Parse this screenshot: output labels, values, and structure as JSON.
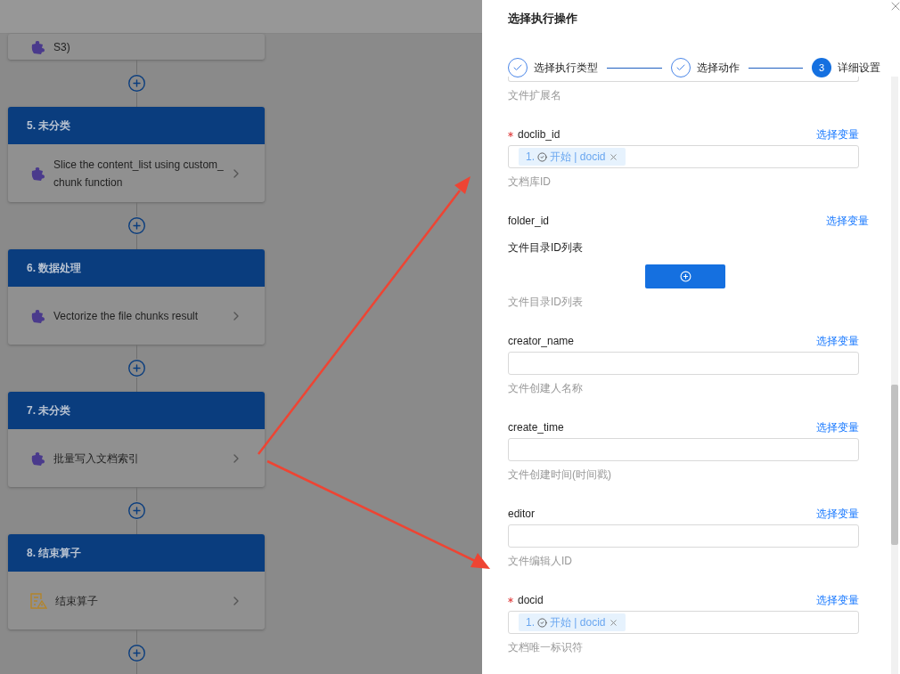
{
  "flow": {
    "nodes": [
      {
        "partial": true,
        "text": "S3)",
        "kind": "plugin"
      },
      {
        "title": "5. 未分类",
        "text": "Slice the content_list using custom_ chunk function",
        "kind": "plugin"
      },
      {
        "title": "6. 数据处理",
        "text": "Vectorize the file chunks result",
        "kind": "plugin"
      },
      {
        "title": "7. 未分类",
        "text": "批量写入文档索引",
        "kind": "plugin"
      },
      {
        "title": "8. 结束算子",
        "text": "结束算子",
        "kind": "end"
      }
    ]
  },
  "drawer": {
    "title": "选择执行操作",
    "steps": [
      {
        "label": "选择执行类型",
        "kind": "done"
      },
      {
        "label": "选择动作",
        "kind": "done"
      },
      {
        "label": "详细设置",
        "kind": "current",
        "number": "3"
      }
    ],
    "fields": [
      {
        "kind": "partial",
        "hint": "文件扩展名"
      },
      {
        "kind": "tags",
        "name": "doclib_id",
        "required": true,
        "link": "选择变量",
        "tags": [
          {
            "number": "1.",
            "label": "开始 | docid"
          }
        ],
        "hint": "文档库ID"
      },
      {
        "kind": "list",
        "name": "folder_id",
        "required": false,
        "link": "选择变量",
        "sublabel": "文件目录ID列表",
        "hint": "文件目录ID列表"
      },
      {
        "kind": "input",
        "name": "creator_name",
        "required": false,
        "link": "选择变量",
        "hint": "文件创建人名称"
      },
      {
        "kind": "input",
        "name": "create_time",
        "required": false,
        "link": "选择变量",
        "hint": "文件创建时间(时间戳)"
      },
      {
        "kind": "input",
        "name": "editor",
        "required": false,
        "link": "选择变量",
        "hint": "文件编辑人ID"
      },
      {
        "kind": "tags",
        "name": "docid",
        "required": true,
        "link": "选择变量",
        "tags": [
          {
            "number": "1.",
            "label": "开始 | docid"
          }
        ],
        "hint": "文档唯一标识符"
      }
    ]
  }
}
